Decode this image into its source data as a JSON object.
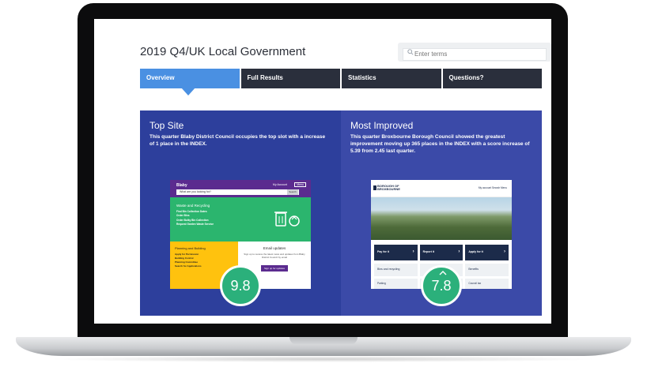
{
  "page": {
    "title": "2019 Q4/UK Local Government",
    "search_placeholder": "Enter terms"
  },
  "tabs": [
    {
      "label": "Overview",
      "active": true
    },
    {
      "label": "Full Results",
      "active": false
    },
    {
      "label": "Statistics",
      "active": false
    },
    {
      "label": "Questions?",
      "active": false
    }
  ],
  "top_site": {
    "heading": "Top Site",
    "text": "This quarter Blaby District Council occupies the top slot with a increase of 1 place in the INDEX.",
    "score": "9.8",
    "thumb": {
      "logo": "Blaby",
      "account": "My Account",
      "menu": "Menu",
      "search_placeholder": "What are you looking for?",
      "search_button": "Search",
      "green_heading": "Waste and Recycling",
      "green_links": [
        "Find Bin Collection Dates",
        "Order Bins",
        "Order Bulky Bin Collection",
        "Request Garden Waste Service"
      ],
      "yellow_heading": "Planning and Building",
      "yellow_links": [
        "Apply for Permission",
        "Building Control",
        "Planning Committee",
        "Search for Applications"
      ],
      "email_heading": "Email updates",
      "email_text": "Sign up to receive the latest news and updates from Blaby District Council by email",
      "email_button": "Sign up for updates"
    },
    "colors": {
      "panel": "#2d3f9c",
      "score": "#2bb07b"
    }
  },
  "most_improved": {
    "heading": "Most Improved",
    "text": "This quarter Broxbourne Borough Council showed the greatest improvement moving up 365 places in the INDEX with a score increase of 5.39 from 2.45 last quarter.",
    "score": "7.8",
    "score_icon": "chevron-up-icon",
    "thumb": {
      "logo_line1": "BOROUGH OF",
      "logo_line2": "BROXBOURNE",
      "nav": "My account    Search    Menu",
      "tiles": [
        "Pay for it",
        "Report it",
        "Apply for it"
      ],
      "tiles2": [
        "Bins and recycling",
        "",
        "Benefits"
      ],
      "tiles3": [
        "Parking",
        "",
        "Council tax"
      ]
    },
    "colors": {
      "panel": "#3b4aa8",
      "score": "#2bb07b"
    }
  },
  "colors": {
    "tab_active": "#4a90e2",
    "tab_inactive": "#2a2f3c",
    "bezel": "#0c0c0d"
  }
}
